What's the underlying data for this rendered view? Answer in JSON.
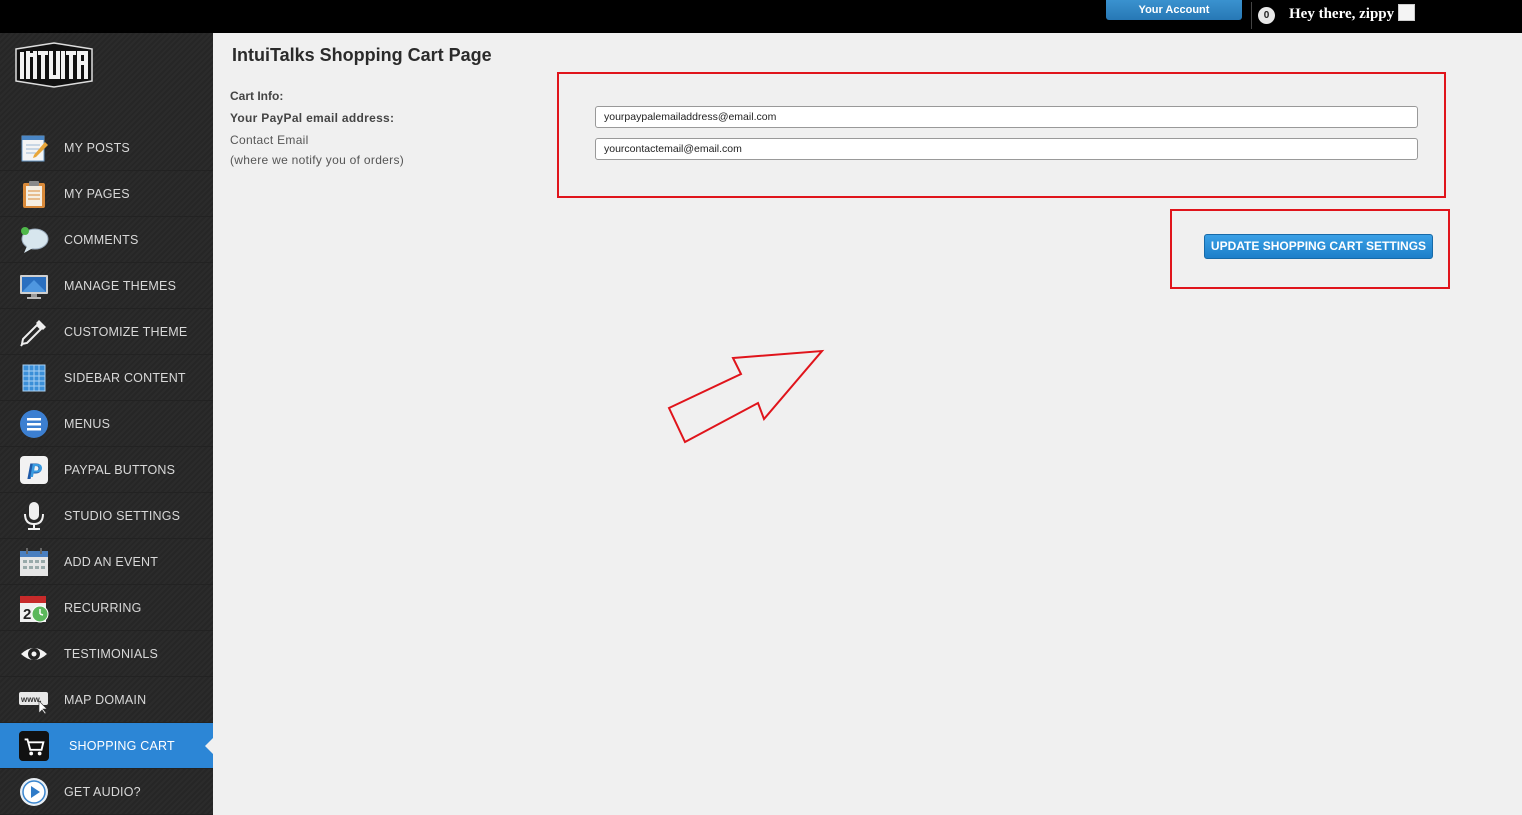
{
  "topbar": {
    "account_label": "Your Account",
    "notification_count": "0",
    "greeting": "Hey there, zippy"
  },
  "sidebar": {
    "logo_text": "INTUITALKS",
    "items": [
      {
        "label": "MY POSTS",
        "icon": "notepad-pencil-icon"
      },
      {
        "label": "MY PAGES",
        "icon": "clipboard-icon"
      },
      {
        "label": "COMMENTS",
        "icon": "speech-bubble-icon"
      },
      {
        "label": "MANAGE THEMES",
        "icon": "monitor-icon"
      },
      {
        "label": "CUSTOMIZE THEME",
        "icon": "eyedropper-icon"
      },
      {
        "label": "SIDEBAR CONTENT",
        "icon": "grid-panel-icon"
      },
      {
        "label": "MENUS",
        "icon": "menu-list-icon"
      },
      {
        "label": "PAYPAL BUTTONS",
        "icon": "paypal-icon"
      },
      {
        "label": "STUDIO SETTINGS",
        "icon": "microphone-icon"
      },
      {
        "label": "ADD AN EVENT",
        "icon": "calendar-icon"
      },
      {
        "label": "RECURRING",
        "icon": "calendar-clock-icon"
      },
      {
        "label": "TESTIMONIALS",
        "icon": "eye-icon"
      },
      {
        "label": "MAP DOMAIN",
        "icon": "www-cursor-icon"
      },
      {
        "label": "SHOPPING CART",
        "icon": "shopping-cart-icon",
        "active": true
      },
      {
        "label": "GET AUDIO?",
        "icon": "play-icon"
      }
    ]
  },
  "main": {
    "title": "IntuiTalks Shopping Cart Page",
    "cart_info_label": "Cart Info:",
    "paypal_label": "Your PayPal email address:",
    "contact_label": "Contact Email",
    "contact_note": "(where we notify you of orders)",
    "paypal_value": "yourpaypalemailaddress@email.com",
    "contact_value": "yourcontactemail@email.com",
    "update_button": "UPDATE SHOPPING CART SETTINGS"
  },
  "colors": {
    "accent": "#2c86d6",
    "annotation": "#e0141b",
    "sidebar_bg": "#2b2b2b",
    "page_bg": "#f0f0f0"
  }
}
